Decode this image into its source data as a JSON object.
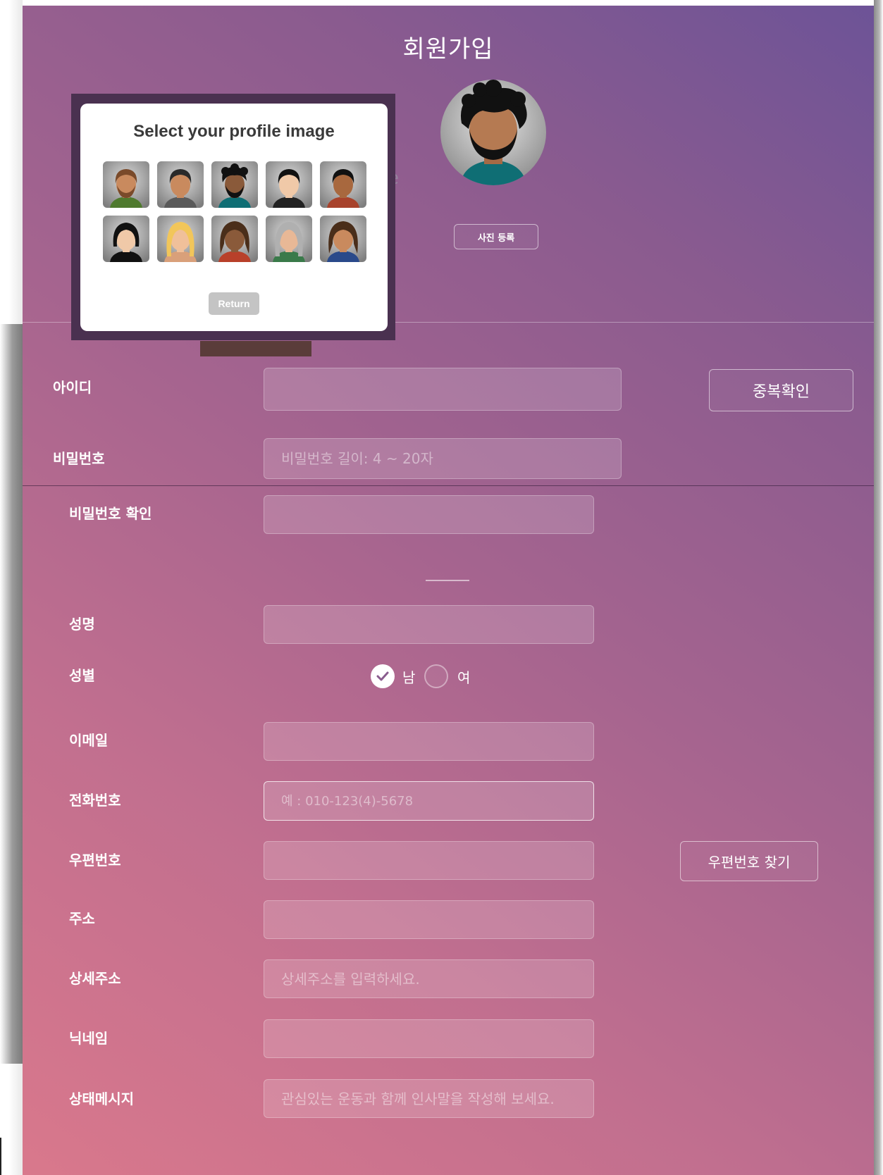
{
  "page": {
    "title": "회원가입"
  },
  "profile": {
    "photo_button": "사진 등록"
  },
  "modal": {
    "title": "Select your profile image",
    "return_label": "Return",
    "avatars": [
      "avatar-1",
      "avatar-2",
      "avatar-3",
      "avatar-4",
      "avatar-5",
      "avatar-6",
      "avatar-7",
      "avatar-8",
      "avatar-9",
      "avatar-10"
    ]
  },
  "form": {
    "id_label": "아이디",
    "dup_check_button": "중복확인",
    "password_label": "비밀번호",
    "password_placeholder": "비밀번호 길이: 4 ~ 20자",
    "password_confirm_label": "비밀번호 확인",
    "name_label": "성명",
    "gender_label": "성별",
    "gender_male": "남",
    "gender_female": "여",
    "gender_selected": "남",
    "email_label": "이메일",
    "phone_label": "전화번호",
    "phone_placeholder": "예 : 010-123(4)-5678",
    "postcode_label": "우편번호",
    "postcode_button": "우편번호 찾기",
    "address_label": "주소",
    "address_detail_label": "상세주소",
    "address_detail_placeholder": "상세주소를 입력하세요.",
    "nickname_label": "닉네임",
    "status_label": "상태메시지",
    "status_placeholder": "관심있는 운동과 함께 인사말을 작성해 보세요."
  },
  "colors": {
    "bg_top": "#6d5397",
    "bg_bottom": "#d9788c",
    "modal_bg": "#ffffff",
    "return_btn": "#c4c4c4"
  }
}
